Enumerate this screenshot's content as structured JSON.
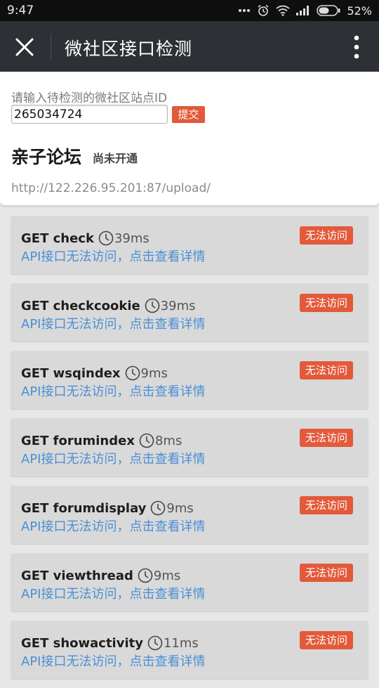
{
  "status_bar": {
    "time": "9:47",
    "battery": "52%"
  },
  "navbar": {
    "title": "微社区接口检测"
  },
  "form": {
    "label": "请输入待检测的微社区站点ID",
    "input_value": "265034724",
    "submit_label": "提交"
  },
  "site": {
    "name": "亲子论坛",
    "status": "尚未开通",
    "url": "http://122.226.95.201:87/upload/"
  },
  "apis": [
    {
      "name": "GET check",
      "time": "39ms",
      "detail": "API接口无法访问，点击查看详情",
      "badge": "无法访问"
    },
    {
      "name": "GET checkcookie",
      "time": "39ms",
      "detail": "API接口无法访问，点击查看详情",
      "badge": "无法访问"
    },
    {
      "name": "GET wsqindex",
      "time": "9ms",
      "detail": "API接口无法访问，点击查看详情",
      "badge": "无法访问"
    },
    {
      "name": "GET forumindex",
      "time": "8ms",
      "detail": "API接口无法访问，点击查看详情",
      "badge": "无法访问"
    },
    {
      "name": "GET forumdisplay",
      "time": "9ms",
      "detail": "API接口无法访问，点击查看详情",
      "badge": "无法访问"
    },
    {
      "name": "GET viewthread",
      "time": "9ms",
      "detail": "API接口无法访问，点击查看详情",
      "badge": "无法访问"
    },
    {
      "name": "GET showactivity",
      "time": "11ms",
      "detail": "API接口无法访问，点击查看详情",
      "badge": "无法访问"
    }
  ],
  "colors": {
    "navbar": "#2d3035",
    "error_badge": "#e25a3a",
    "link": "#4a8fd6"
  },
  "icons": {
    "close": "close-icon",
    "more": "more-vertical-icon",
    "clock": "clock-icon"
  }
}
